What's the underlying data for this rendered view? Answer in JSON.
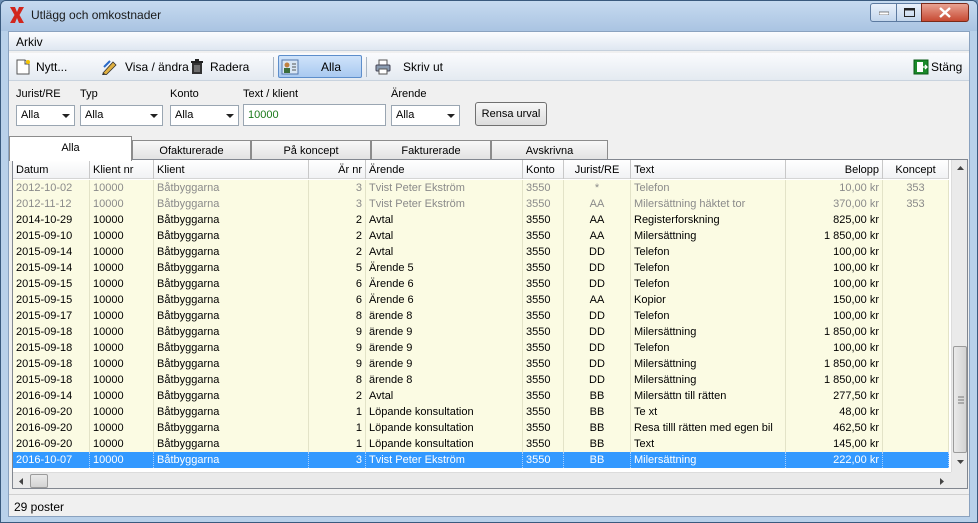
{
  "window": {
    "title": "Utlägg och omkostnader"
  },
  "menu": {
    "arkiv": "Arkiv"
  },
  "toolbar": {
    "nytt": "Nytt...",
    "visa_andra": "Visa / ändra",
    "radera": "Radera",
    "alla": "Alla",
    "skriv_ut": "Skriv ut",
    "stang": "Stäng"
  },
  "filters": {
    "jurist_label": "Jurist/RE",
    "jurist_value": "Alla",
    "typ_label": "Typ",
    "typ_value": "Alla",
    "konto_label": "Konto",
    "konto_value": "Alla",
    "text_label": "Text / klient",
    "text_value": "10000",
    "arende_label": "Ärende",
    "arende_value": "Alla",
    "rensa": "Rensa urval"
  },
  "tabs": [
    "Alla",
    "Ofakturerade",
    "På koncept",
    "Fakturerade",
    "Avskrivna"
  ],
  "columns": [
    "Datum",
    "Klient nr",
    "Klient",
    "Är nr",
    "Ärende",
    "Konto",
    "Jurist/RE",
    "Text",
    "Belopp",
    "Koncept"
  ],
  "rows": [
    [
      "2012-10-02",
      "10000",
      "Båtbyggarna",
      "3",
      "Tvist Peter Ekström",
      "3550",
      "*",
      "Telefon",
      "10,00 kr",
      "353"
    ],
    [
      "2012-11-12",
      "10000",
      "Båtbyggarna",
      "3",
      "Tvist Peter Ekström",
      "3550",
      "AA",
      "Milersättning häktet tor",
      "370,00 kr",
      "353"
    ],
    [
      "2014-10-29",
      "10000",
      "Båtbyggarna",
      "2",
      "Avtal",
      "3550",
      "AA",
      "Registerforskning",
      "825,00 kr",
      ""
    ],
    [
      "2015-09-10",
      "10000",
      "Båtbyggarna",
      "2",
      "Avtal",
      "3550",
      "AA",
      "Milersättning",
      "1 850,00 kr",
      ""
    ],
    [
      "2015-09-14",
      "10000",
      "Båtbyggarna",
      "2",
      "Avtal",
      "3550",
      "DD",
      "Telefon",
      "100,00 kr",
      ""
    ],
    [
      "2015-09-14",
      "10000",
      "Båtbyggarna",
      "5",
      "Ärende 5",
      "3550",
      "DD",
      "Telefon",
      "100,00 kr",
      ""
    ],
    [
      "2015-09-15",
      "10000",
      "Båtbyggarna",
      "6",
      "Ärende 6",
      "3550",
      "DD",
      "Telefon",
      "100,00 kr",
      ""
    ],
    [
      "2015-09-15",
      "10000",
      "Båtbyggarna",
      "6",
      "Ärende 6",
      "3550",
      "AA",
      "Kopior",
      "150,00 kr",
      ""
    ],
    [
      "2015-09-17",
      "10000",
      "Båtbyggarna",
      "8",
      "ärende 8",
      "3550",
      "DD",
      "Telefon",
      "100,00 kr",
      ""
    ],
    [
      "2015-09-18",
      "10000",
      "Båtbyggarna",
      "9",
      "ärende 9",
      "3550",
      "DD",
      "Milersättning",
      "1 850,00 kr",
      ""
    ],
    [
      "2015-09-18",
      "10000",
      "Båtbyggarna",
      "9",
      "ärende 9",
      "3550",
      "DD",
      "Telefon",
      "100,00 kr",
      ""
    ],
    [
      "2015-09-18",
      "10000",
      "Båtbyggarna",
      "9",
      "ärende 9",
      "3550",
      "DD",
      "Milersättning",
      "1 850,00 kr",
      ""
    ],
    [
      "2015-09-18",
      "10000",
      "Båtbyggarna",
      "8",
      "ärende 8",
      "3550",
      "DD",
      "Milersättning",
      "1 850,00 kr",
      ""
    ],
    [
      "2016-09-14",
      "10000",
      "Båtbyggarna",
      "2",
      "Avtal",
      "3550",
      "BB",
      "Milersättn till rätten",
      "277,50 kr",
      ""
    ],
    [
      "2016-09-20",
      "10000",
      "Båtbyggarna",
      "1",
      "Löpande konsultation",
      "3550",
      "BB",
      "Te xt",
      "48,00 kr",
      ""
    ],
    [
      "2016-09-20",
      "10000",
      "Båtbyggarna",
      "1",
      "Löpande konsultation",
      "3550",
      "BB",
      "Resa tilll rätten med egen bil",
      "462,50 kr",
      ""
    ],
    [
      "2016-09-20",
      "10000",
      "Båtbyggarna",
      "1",
      "Löpande konsultation",
      "3550",
      "BB",
      "Text",
      "145,00 kr",
      ""
    ],
    [
      "2016-10-07",
      "10000",
      "Båtbyggarna",
      "3",
      "Tvist Peter Ekström",
      "3550",
      "BB",
      "Milersättning",
      "222,00 kr",
      ""
    ]
  ],
  "status": {
    "count": "29 poster"
  }
}
